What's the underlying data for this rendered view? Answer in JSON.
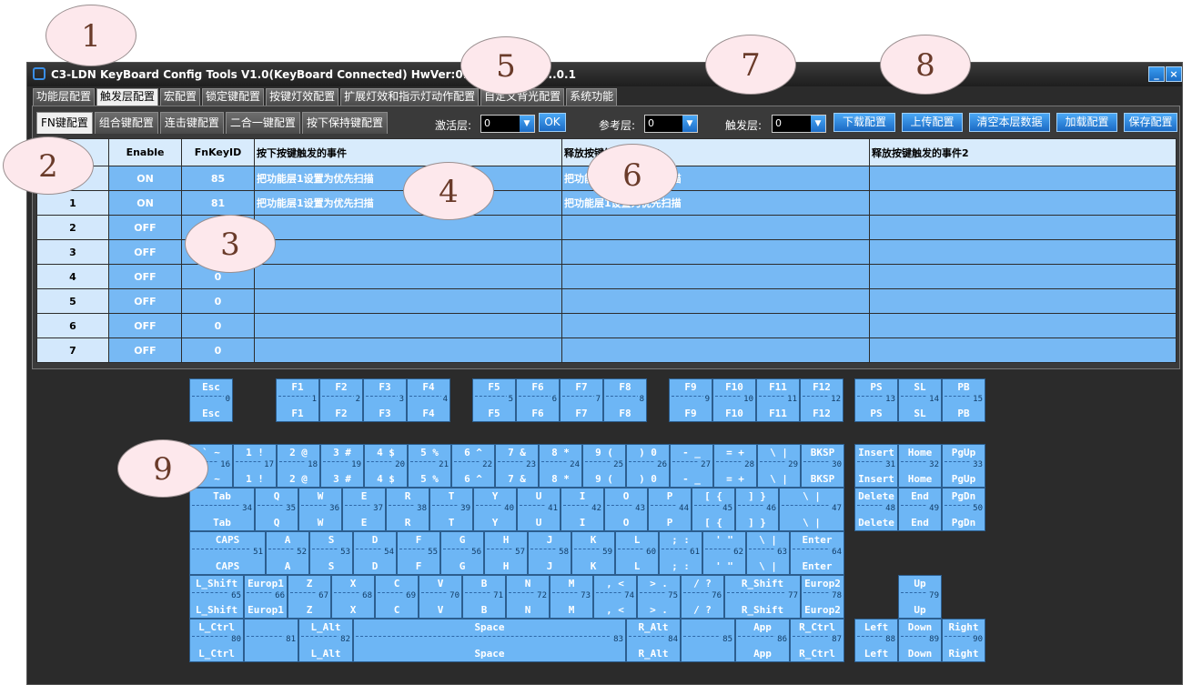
{
  "window": {
    "title": "C3-LDN KeyBoard Config Tools V1.0(KeyBoard Connected)  HwVer:0.2  FwVer:0.2  ...0.1",
    "minimize": "_",
    "close": "×"
  },
  "tabs": [
    "功能层配置",
    "触发层配置",
    "宏配置",
    "锁定键配置",
    "按键灯效配置",
    "扩展灯效和指示灯动作配置",
    "自定义背光配置",
    "系统功能"
  ],
  "active_tab": 1,
  "subtabs": [
    "FN键配置",
    "组合键配置",
    "连击键配置",
    "二合一键配置",
    "按下保持键配置"
  ],
  "active_subtab": 0,
  "toolbar": {
    "activate_label": "激活层:",
    "activate_value": "0",
    "ok": "OK",
    "ref_label": "参考层:",
    "ref_value": "0",
    "trigger_label": "触发层:",
    "trigger_value": "0",
    "download": "下载配置",
    "upload": "上传配置",
    "clear": "清空本层数据",
    "load": "加载配置",
    "save": "保存配置"
  },
  "table": {
    "headers": [
      "",
      "Enable",
      "FnKeyID",
      "按下按键触发的事件",
      "释放按键触发的事件1",
      "释放按键触发的事件2"
    ],
    "rows": [
      [
        "0",
        "ON",
        "85",
        "把功能层1设置为优先扫描",
        "把功能层1设置为优先扫描",
        ""
      ],
      [
        "1",
        "ON",
        "81",
        "把功能层1设置为优先扫描",
        "把功能层1设置为优先扫描",
        ""
      ],
      [
        "2",
        "OFF",
        "0",
        "",
        "",
        ""
      ],
      [
        "3",
        "OFF",
        "0",
        "",
        "",
        ""
      ],
      [
        "4",
        "OFF",
        "0",
        "",
        "",
        ""
      ],
      [
        "5",
        "OFF",
        "0",
        "",
        "",
        ""
      ],
      [
        "6",
        "OFF",
        "0",
        "",
        "",
        ""
      ],
      [
        "7",
        "OFF",
        "0",
        "",
        "",
        ""
      ]
    ]
  },
  "keyboard": [
    {
      "t": "Esc",
      "n": "0",
      "b": "Esc"
    },
    {
      "t": "F1",
      "n": "1",
      "b": "F1"
    },
    {
      "t": "F2",
      "n": "2",
      "b": "F2"
    },
    {
      "t": "F3",
      "n": "3",
      "b": "F3"
    },
    {
      "t": "F4",
      "n": "4",
      "b": "F4"
    },
    {
      "t": "F5",
      "n": "5",
      "b": "F5"
    },
    {
      "t": "F6",
      "n": "6",
      "b": "F6"
    },
    {
      "t": "F7",
      "n": "7",
      "b": "F7"
    },
    {
      "t": "F8",
      "n": "8",
      "b": "F8"
    },
    {
      "t": "F9",
      "n": "9",
      "b": "F9"
    },
    {
      "t": "F10",
      "n": "10",
      "b": "F10"
    },
    {
      "t": "F11",
      "n": "11",
      "b": "F11"
    },
    {
      "t": "F12",
      "n": "12",
      "b": "F12"
    },
    {
      "t": "PS",
      "n": "13",
      "b": "PS"
    },
    {
      "t": "SL",
      "n": "14",
      "b": "SL"
    },
    {
      "t": "PB",
      "n": "15",
      "b": "PB"
    },
    {
      "t": "` ~",
      "n": "16",
      "b": "` ~"
    },
    {
      "t": "1 !",
      "n": "17",
      "b": "1 !"
    },
    {
      "t": "2 @",
      "n": "18",
      "b": "2 @"
    },
    {
      "t": "3 #",
      "n": "19",
      "b": "3 #"
    },
    {
      "t": "4 $",
      "n": "20",
      "b": "4 $"
    },
    {
      "t": "5 %",
      "n": "21",
      "b": "5 %"
    },
    {
      "t": "6 ^",
      "n": "22",
      "b": "6 ^"
    },
    {
      "t": "7 &",
      "n": "23",
      "b": "7 &"
    },
    {
      "t": "8 *",
      "n": "24",
      "b": "8 *"
    },
    {
      "t": "9 (",
      "n": "25",
      "b": "9 ("
    },
    {
      "t": ") 0",
      "n": "26",
      "b": ") 0"
    },
    {
      "t": "- _",
      "n": "27",
      "b": "- _"
    },
    {
      "t": "= +",
      "n": "28",
      "b": "= +"
    },
    {
      "t": "\\ |",
      "n": "29",
      "b": "\\ |"
    },
    {
      "t": "BKSP",
      "n": "30",
      "b": "BKSP"
    },
    {
      "t": "Insert",
      "n": "31",
      "b": "Insert"
    },
    {
      "t": "Home",
      "n": "32",
      "b": "Home"
    },
    {
      "t": "PgUp",
      "n": "33",
      "b": "PgUp"
    },
    {
      "t": "Tab",
      "n": "34",
      "b": "Tab"
    },
    {
      "t": "Q",
      "n": "35",
      "b": "Q"
    },
    {
      "t": "W",
      "n": "36",
      "b": "W"
    },
    {
      "t": "E",
      "n": "37",
      "b": "E"
    },
    {
      "t": "R",
      "n": "38",
      "b": "R"
    },
    {
      "t": "T",
      "n": "39",
      "b": "T"
    },
    {
      "t": "Y",
      "n": "40",
      "b": "Y"
    },
    {
      "t": "U",
      "n": "41",
      "b": "U"
    },
    {
      "t": "I",
      "n": "42",
      "b": "I"
    },
    {
      "t": "O",
      "n": "43",
      "b": "O"
    },
    {
      "t": "P",
      "n": "44",
      "b": "P"
    },
    {
      "t": "[ {",
      "n": "45",
      "b": "[ {"
    },
    {
      "t": "] }",
      "n": "46",
      "b": "] }"
    },
    {
      "t": "\\ |",
      "n": "47",
      "b": "\\ |"
    },
    {
      "t": "Delete",
      "n": "48",
      "b": "Delete"
    },
    {
      "t": "End",
      "n": "49",
      "b": "End"
    },
    {
      "t": "PgDn",
      "n": "50",
      "b": "PgDn"
    },
    {
      "t": "CAPS",
      "n": "51",
      "b": "CAPS"
    },
    {
      "t": "A",
      "n": "52",
      "b": "A"
    },
    {
      "t": "S",
      "n": "53",
      "b": "S"
    },
    {
      "t": "D",
      "n": "54",
      "b": "D"
    },
    {
      "t": "F",
      "n": "55",
      "b": "F"
    },
    {
      "t": "G",
      "n": "56",
      "b": "G"
    },
    {
      "t": "H",
      "n": "57",
      "b": "H"
    },
    {
      "t": "J",
      "n": "58",
      "b": "J"
    },
    {
      "t": "K",
      "n": "59",
      "b": "K"
    },
    {
      "t": "L",
      "n": "60",
      "b": "L"
    },
    {
      "t": "; :",
      "n": "61",
      "b": "; :"
    },
    {
      "t": "' \"",
      "n": "62",
      "b": "' \""
    },
    {
      "t": "\\ |",
      "n": "63",
      "b": "\\ |"
    },
    {
      "t": "Enter",
      "n": "64",
      "b": "Enter"
    },
    {
      "t": "L_Shift",
      "n": "65",
      "b": "L_Shift"
    },
    {
      "t": "Europ1",
      "n": "66",
      "b": "Europ1"
    },
    {
      "t": "Z",
      "n": "67",
      "b": "Z"
    },
    {
      "t": "X",
      "n": "68",
      "b": "X"
    },
    {
      "t": "C",
      "n": "69",
      "b": "C"
    },
    {
      "t": "V",
      "n": "70",
      "b": "V"
    },
    {
      "t": "B",
      "n": "71",
      "b": "B"
    },
    {
      "t": "N",
      "n": "72",
      "b": "N"
    },
    {
      "t": "M",
      "n": "73",
      "b": "M"
    },
    {
      "t": ", <",
      "n": "74",
      "b": ", <"
    },
    {
      "t": "> .",
      "n": "75",
      "b": "> ."
    },
    {
      "t": "/ ?",
      "n": "76",
      "b": "/ ?"
    },
    {
      "t": "R_Shift",
      "n": "77",
      "b": "R_Shift"
    },
    {
      "t": "Europ2",
      "n": "78",
      "b": "Europ2"
    },
    {
      "t": "Up",
      "n": "79",
      "b": "Up"
    },
    {
      "t": "L_Ctrl",
      "n": "80",
      "b": "L_Ctrl"
    },
    {
      "t": "",
      "n": "81",
      "b": ""
    },
    {
      "t": "L_Alt",
      "n": "82",
      "b": "L_Alt"
    },
    {
      "t": "Space",
      "n": "83",
      "b": "Space"
    },
    {
      "t": "R_Alt",
      "n": "84",
      "b": "R_Alt"
    },
    {
      "t": "",
      "n": "85",
      "b": ""
    },
    {
      "t": "App",
      "n": "86",
      "b": "App"
    },
    {
      "t": "R_Ctrl",
      "n": "87",
      "b": "R_Ctrl"
    },
    {
      "t": "Left",
      "n": "88",
      "b": "Left"
    },
    {
      "t": "Down",
      "n": "89",
      "b": "Down"
    },
    {
      "t": "Right",
      "n": "90",
      "b": "Right"
    }
  ],
  "callouts": [
    "1",
    "2",
    "3",
    "4",
    "5",
    "6",
    "7",
    "8",
    "9"
  ]
}
